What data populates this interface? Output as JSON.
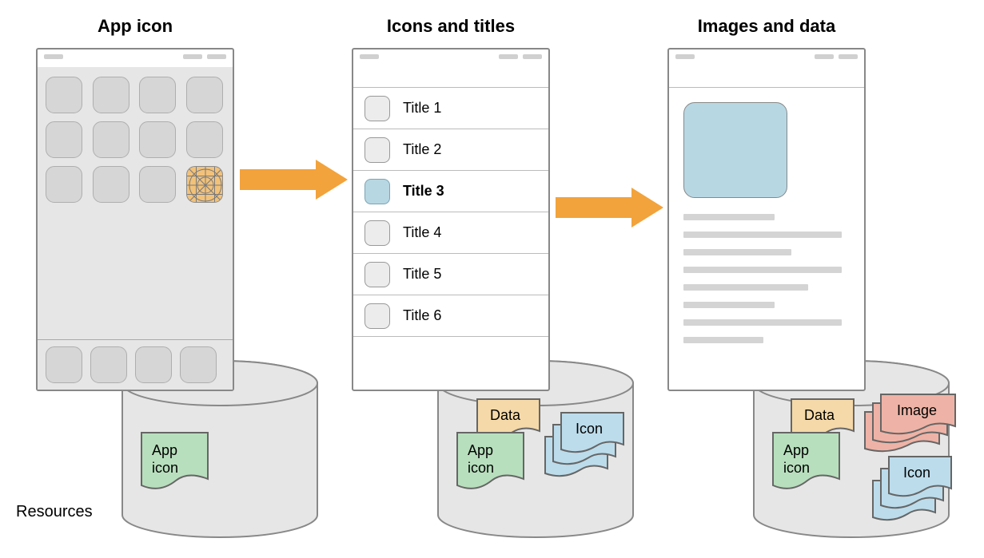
{
  "columns": {
    "c1_title": "App icon",
    "c2_title": "Icons and titles",
    "c3_title": "Images and data"
  },
  "list": {
    "items": [
      {
        "label": "Title 1",
        "selected": false
      },
      {
        "label": "Title 2",
        "selected": false
      },
      {
        "label": "Title 3",
        "selected": true
      },
      {
        "label": "Title 4",
        "selected": false
      },
      {
        "label": "Title 5",
        "selected": false
      },
      {
        "label": "Title 6",
        "selected": false
      }
    ]
  },
  "resources_label": "Resources",
  "resource_cards": {
    "app_icon": "App\nicon",
    "data": "Data",
    "icon": "Icon",
    "image": "Image"
  },
  "colors": {
    "arrow": "#f2a33c",
    "green": "#b8dfbd",
    "orange": "#f5d9a8",
    "blue": "#bcdceb",
    "red": "#eeb3a6",
    "highlight_icon": "#b7d7e3"
  }
}
